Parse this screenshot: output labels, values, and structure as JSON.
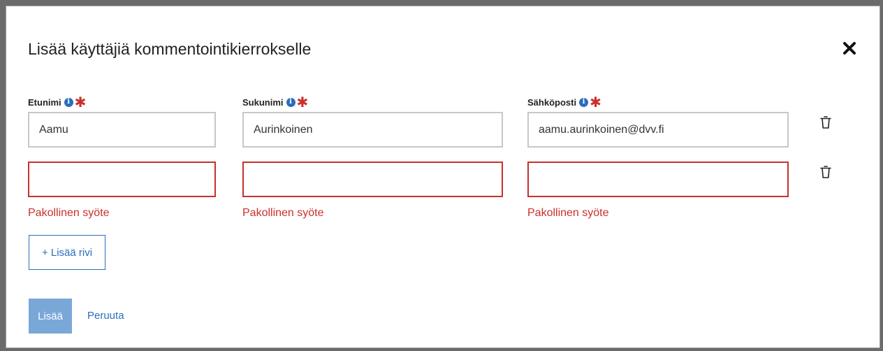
{
  "dialog": {
    "title": "Lisää käyttäjiä kommentointikierrokselle",
    "close_icon": "close-icon"
  },
  "columns": [
    {
      "label": "Etunimi",
      "info_icon": "info-icon",
      "required_icon": "required-asterisk-icon"
    },
    {
      "label": "Sukunimi",
      "info_icon": "info-icon",
      "required_icon": "required-asterisk-icon"
    },
    {
      "label": "Sähköposti",
      "info_icon": "info-icon",
      "required_icon": "required-asterisk-icon"
    }
  ],
  "rows": [
    {
      "first_name": "Aamu",
      "last_name": "Aurinkoinen",
      "email": "aamu.aurinkoinen@dvv.fi",
      "has_error": false,
      "delete_icon": "trash-icon"
    },
    {
      "first_name": "",
      "last_name": "",
      "email": "",
      "has_error": true,
      "error_text": "Pakollinen syöte",
      "delete_icon": "trash-icon"
    }
  ],
  "add_row_label": "+ Lisää rivi",
  "actions": {
    "submit_label": "Lisää",
    "cancel_label": "Peruuta"
  },
  "colors": {
    "accent": "#2a6ebb",
    "error": "#c9302c",
    "submit_disabled": "#79a8d8"
  }
}
